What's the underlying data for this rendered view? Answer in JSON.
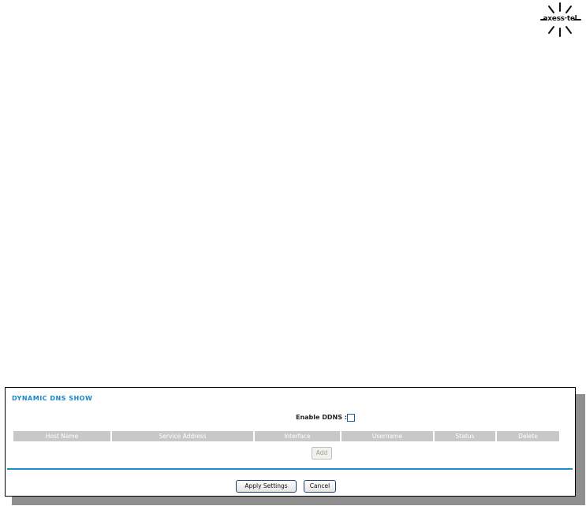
{
  "logo": {
    "text": "axess·tel",
    "icon": "starburst-logo-icon"
  },
  "panel": {
    "title": "DYNAMIC DNS SHOW",
    "enable_label": "Enable DDNS :",
    "enable_checked": false
  },
  "table": {
    "columns": [
      "Host Name",
      "Service Address",
      "Interface",
      "Username",
      "Status",
      "Delete"
    ]
  },
  "buttons": {
    "add": "Add",
    "apply": "Apply Settings",
    "cancel": "Cancel"
  },
  "colors": {
    "title": "#1b86c8",
    "divider": "#1790c8",
    "header_bg": "#c8c8c8"
  }
}
